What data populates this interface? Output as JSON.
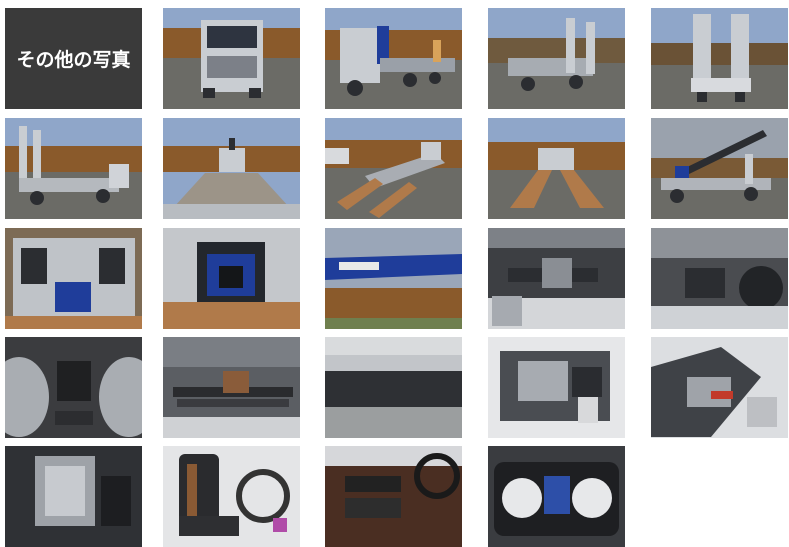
{
  "gallery": {
    "title": "その他の写真",
    "photos": [
      {
        "icon": "truck-front-photo-icon"
      },
      {
        "icon": "truck-side-crane-photo-icon"
      },
      {
        "icon": "truck-rear-ramps-photo-icon"
      },
      {
        "icon": "truck-rear-view-photo-icon"
      },
      {
        "icon": "truck-side-ramps-up-photo-icon"
      },
      {
        "icon": "flatbed-deck-photo-icon"
      },
      {
        "icon": "ramps-down-side-photo-icon"
      },
      {
        "icon": "ramps-down-rear-photo-icon"
      },
      {
        "icon": "crane-extended-photo-icon"
      },
      {
        "icon": "headboard-compartment-photo-icon"
      },
      {
        "icon": "crane-base-blue-photo-icon"
      },
      {
        "icon": "crane-boom-sky-photo-icon"
      },
      {
        "icon": "undercarriage-frame-photo-icon"
      },
      {
        "icon": "undercarriage-tank-photo-icon"
      },
      {
        "icon": "tires-underside-photo-icon"
      },
      {
        "icon": "leaf-spring-suspension-photo-icon"
      },
      {
        "icon": "deck-side-rail-photo-icon"
      },
      {
        "icon": "engine-bay-photo-icon"
      },
      {
        "icon": "engine-bay-angle-photo-icon"
      },
      {
        "icon": "engine-top-photo-icon"
      },
      {
        "icon": "driver-seat-photo-icon"
      },
      {
        "icon": "dashboard-console-photo-icon"
      },
      {
        "icon": "instrument-cluster-photo-icon"
      }
    ]
  }
}
